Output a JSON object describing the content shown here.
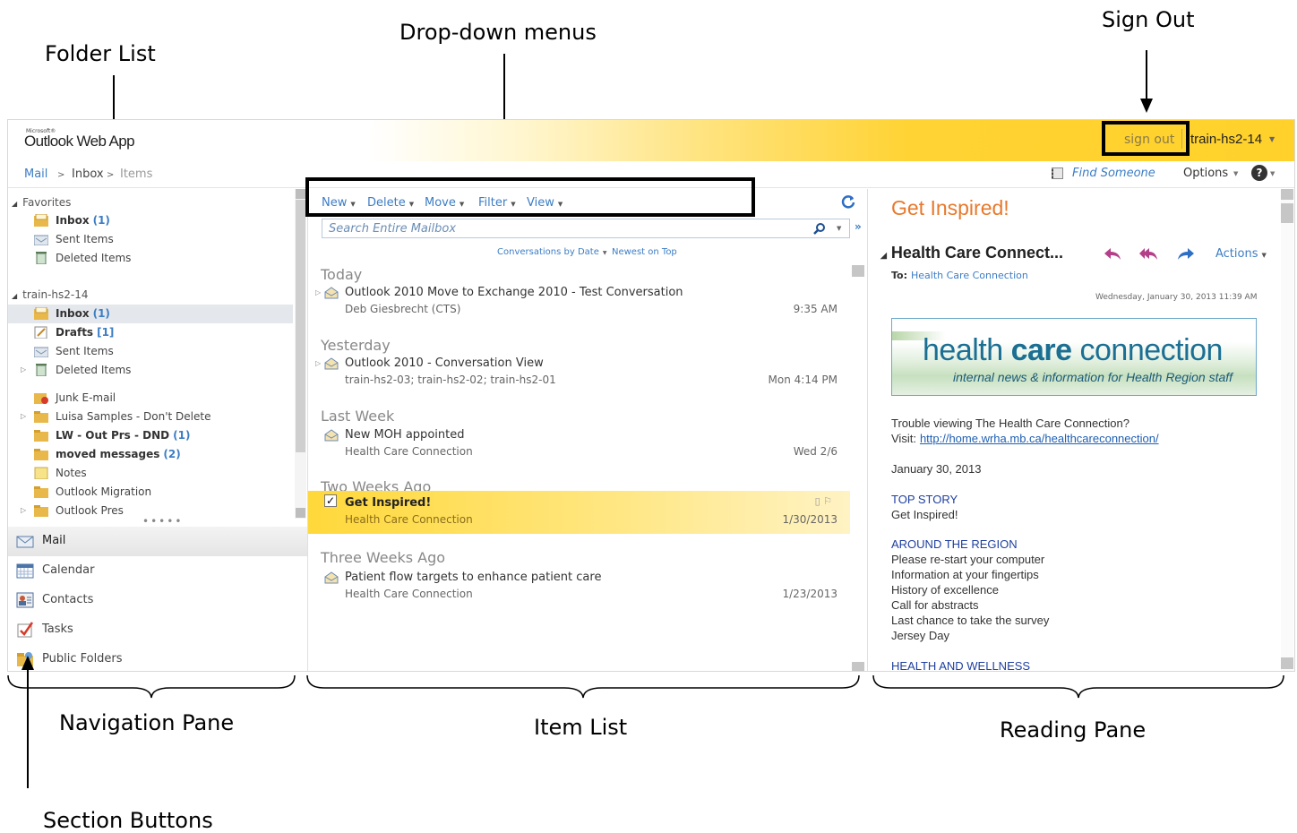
{
  "annotations": {
    "folder_list": "Folder List",
    "dropdown_menus": "Drop-down menus",
    "sign_out": "Sign Out",
    "navigation_pane": "Navigation Pane",
    "item_list": "Item List",
    "reading_pane": "Reading Pane",
    "section_buttons": "Section Buttons"
  },
  "header": {
    "brand_small": "Microsoft®",
    "brand": "Outlook Web App",
    "sign_out": "sign out",
    "user": "train-hs2-14"
  },
  "breadcrumb": {
    "mail": "Mail",
    "inbox": "Inbox",
    "items": "Items"
  },
  "toprow": {
    "find_someone": "Find Someone",
    "options": "Options"
  },
  "favorites": {
    "label": "Favorites",
    "items": [
      {
        "label": "Inbox",
        "count": "(1)"
      },
      {
        "label": "Sent Items",
        "count": ""
      },
      {
        "label": "Deleted Items",
        "count": ""
      }
    ]
  },
  "mailbox": {
    "label": "train-hs2-14",
    "items": [
      {
        "label": "Inbox",
        "count": "(1)"
      },
      {
        "label": "Drafts",
        "count": "[1]"
      },
      {
        "label": "Sent Items",
        "count": ""
      },
      {
        "label": "Deleted Items",
        "count": ""
      },
      {
        "label": "Junk E-mail",
        "count": ""
      },
      {
        "label": "Luisa Samples - Don't Delete",
        "count": ""
      },
      {
        "label": "LW - Out Prs - DND",
        "count": "(1)"
      },
      {
        "label": "moved messages",
        "count": "(2)"
      },
      {
        "label": "Notes",
        "count": ""
      },
      {
        "label": "Outlook Migration",
        "count": ""
      },
      {
        "label": "Outlook Pres",
        "count": ""
      }
    ]
  },
  "sections": [
    "Mail",
    "Calendar",
    "Contacts",
    "Tasks",
    "Public Folders"
  ],
  "toolbar": {
    "new": "New",
    "delete": "Delete",
    "move": "Move",
    "filter": "Filter",
    "view": "View"
  },
  "search": {
    "placeholder": "Search Entire Mailbox"
  },
  "sort": {
    "by": "Conversations by Date",
    "order": "Newest on Top"
  },
  "groups": [
    "Today",
    "Yesterday",
    "Last Week",
    "Two Weeks Ago",
    "Three Weeks Ago"
  ],
  "messages": [
    {
      "subject": "Outlook 2010 Move to Exchange 2010 - Test Conversation",
      "from": "Deb Giesbrecht (CTS)",
      "date": "9:35 AM"
    },
    {
      "subject": "Outlook 2010 - Conversation View",
      "from": "train-hs2-03; train-hs2-02; train-hs2-01",
      "date": "Mon 4:14 PM"
    },
    {
      "subject": "New MOH appointed",
      "from": "Health Care Connection",
      "date": "Wed 2/6"
    },
    {
      "subject": "Get Inspired!",
      "from": "Health Care Connection",
      "date": "1/30/2013"
    },
    {
      "subject": "Patient flow targets to enhance patient care",
      "from": "Health Care Connection",
      "date": "1/23/2013"
    }
  ],
  "reading": {
    "title": "Get Inspired!",
    "conversation": "Health Care Connect...",
    "actions": "Actions",
    "to_label": "To:",
    "to": "Health Care Connection",
    "date": "Wednesday, January 30, 2013 11:39 AM",
    "banner_a": "health ",
    "banner_b": "care",
    "banner_c": " connection",
    "banner_sub": "internal news & information for Health Region staff",
    "trouble": "Trouble viewing The Health Care Connection?",
    "visit": "Visit:",
    "url": "http://home.wrha.mb.ca/healthcareconnection/",
    "body_date": "January 30, 2013",
    "h_top": "TOP STORY",
    "top_item": "Get Inspired!",
    "h_region": "AROUND THE REGION",
    "region_items": [
      "Please re-start your computer",
      "Information at your fingertips",
      "History of excellence",
      "Call for abstracts",
      "Last chance to take the survey",
      "Jersey Day"
    ],
    "h_health": "HEALTH AND WELLNESS"
  },
  "colors": {
    "accent_orange": "#e8792c",
    "link_blue": "#3c7dc4",
    "selection_yellow": "#ffd83a"
  }
}
